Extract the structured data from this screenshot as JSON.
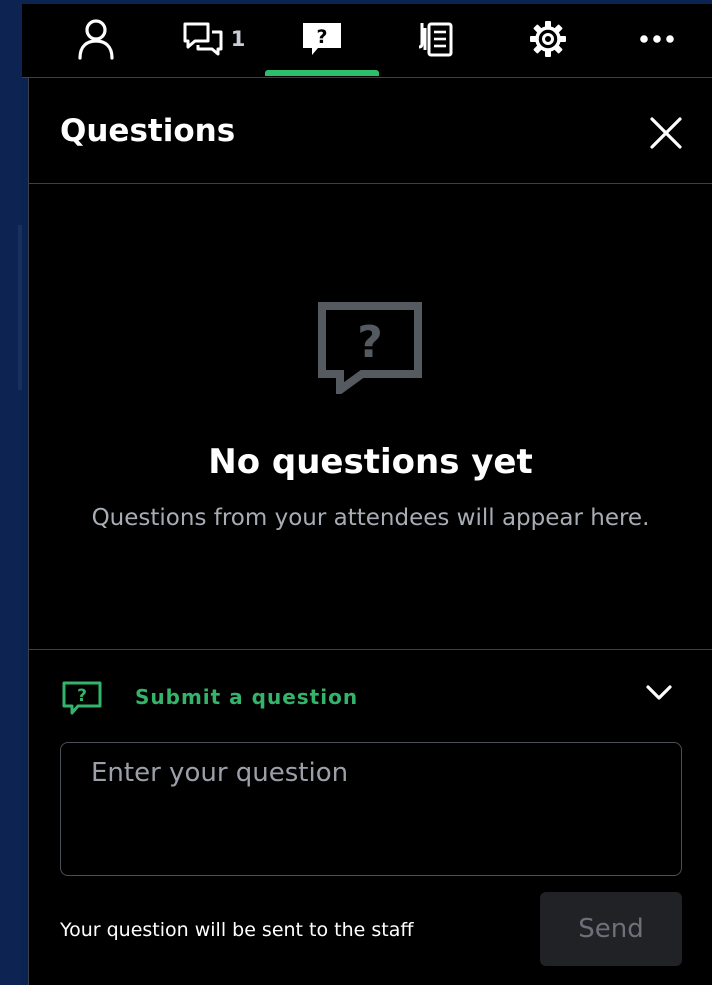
{
  "colors": {
    "accent": "#2dbe6c",
    "panel_background": "#000000",
    "page_background": "#0b2350"
  },
  "tabs": [
    {
      "id": "people",
      "icon": "person-icon"
    },
    {
      "id": "chat",
      "icon": "chat-icon",
      "count": "1"
    },
    {
      "id": "questions",
      "icon": "question-tab-icon",
      "active": true
    },
    {
      "id": "files",
      "icon": "documents-icon"
    },
    {
      "id": "settings",
      "icon": "gear-icon"
    },
    {
      "id": "more",
      "icon": "more-icon"
    }
  ],
  "panel": {
    "title": "Questions"
  },
  "empty_state": {
    "icon": "question-bubble-icon",
    "title": "No questions yet",
    "text": "Questions from your attendees will appear here."
  },
  "submit": {
    "label": "Submit a question",
    "input_placeholder": "Enter your question",
    "input_value": "",
    "helper_text": "Your question will be sent to the staff",
    "send_label": "Send"
  }
}
